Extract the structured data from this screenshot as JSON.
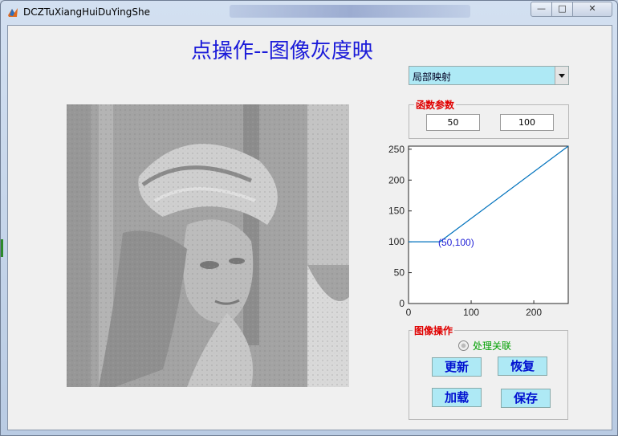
{
  "window": {
    "title": "DCZTuXiangHuiDuYingShe",
    "minimize_glyph": "—",
    "maximize_glyph": "□",
    "close_glyph": "✕"
  },
  "main": {
    "title": "点操作--图像灰度映"
  },
  "mapping_select": {
    "selected": "局部映射"
  },
  "params": {
    "legend": "函数参数",
    "input1": "50",
    "input2": "100"
  },
  "chart_data": {
    "type": "line",
    "series": [
      {
        "x": [
          0,
          50,
          255
        ],
        "y": [
          100,
          100,
          255
        ]
      }
    ],
    "annotation": "(50,100)",
    "xlim": [
      0,
      255
    ],
    "ylim": [
      0,
      255
    ],
    "xticks": [
      "0",
      "100",
      "200"
    ],
    "yticks": [
      "0",
      "50",
      "100",
      "150",
      "200",
      "250"
    ],
    "grid": false,
    "line_color": "#0072bd",
    "annotation_color": "#1f1fd6"
  },
  "ops": {
    "legend": "图像操作",
    "radio_label": "处理关联",
    "update": "更新",
    "restore": "恢复",
    "load": "加载",
    "save": "保存"
  },
  "colors": {
    "button_bg": "#aee9f5",
    "button_text": "#0010d0",
    "legend_text": "#e00000",
    "title_text": "#1b1bd9"
  }
}
